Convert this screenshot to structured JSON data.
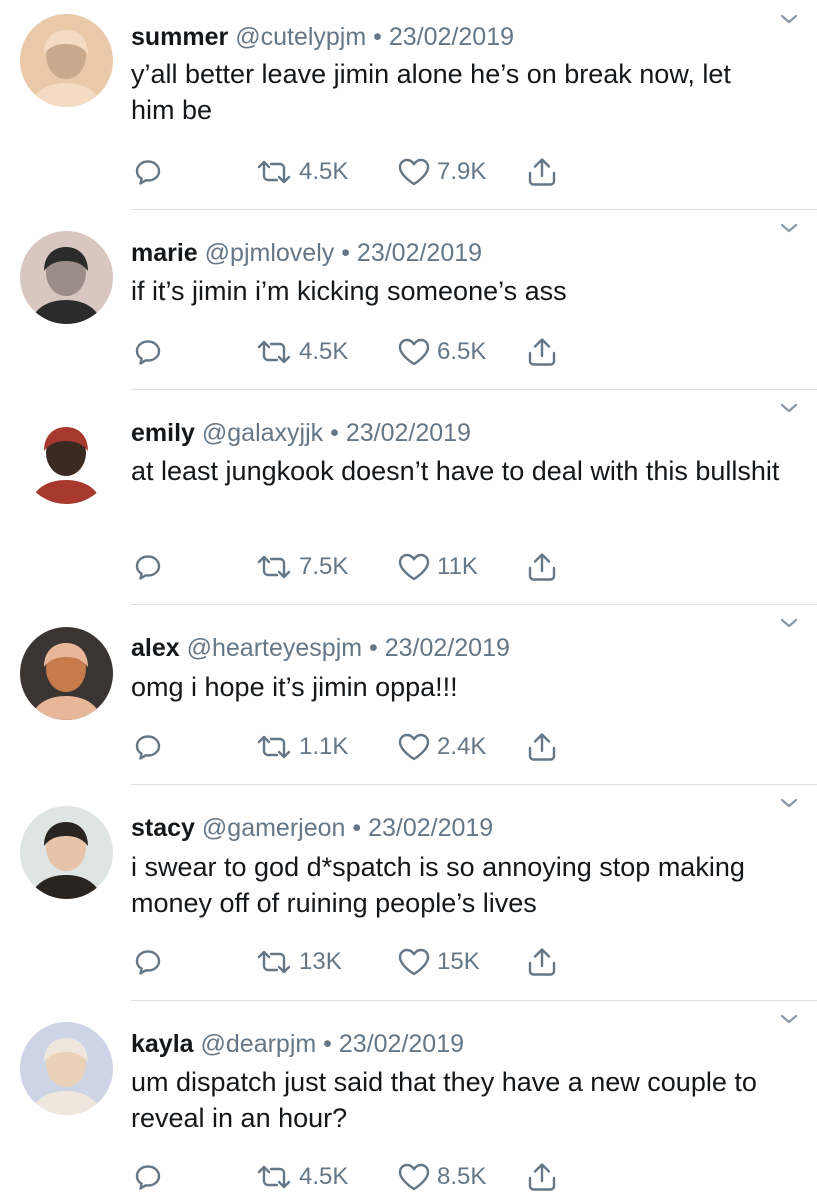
{
  "tweets": [
    {
      "name": "summer",
      "handle": "@cutelypjm",
      "separator": "•",
      "date": "23/02/2019",
      "text": "y’all better leave jimin alone he’s on break now, let him be",
      "retweets": "4.5K",
      "likes": "7.9K",
      "avatar_colors": [
        "#e9c9a8",
        "#f4dcc4",
        "#c9a98b"
      ]
    },
    {
      "name": "marie",
      "handle": "@pjmlovely",
      "separator": "•",
      "date": "23/02/2019",
      "text": "if it’s jimin i’m kicking someone’s ass",
      "retweets": "4.5K",
      "likes": "6.5K",
      "avatar_colors": [
        "#d8c7c0",
        "#2b2b2b",
        "#9a8c86"
      ]
    },
    {
      "name": "emily",
      "handle": "@galaxyjjk",
      "separator": "•",
      "date": "23/02/2019",
      "text": "at least jungkook doesn’t have to deal with this bullshit",
      "retweets": "7.5K",
      "likes": "11K",
      "avatar_colors": [
        "#ffffff",
        "#a8392f",
        "#3a2a22"
      ]
    },
    {
      "name": "alex",
      "handle": "@hearteyespjm",
      "separator": "•",
      "date": "23/02/2019",
      "text": "omg i hope it’s jimin oppa!!!",
      "retweets": "1.1K",
      "likes": "2.4K",
      "avatar_colors": [
        "#3a3533",
        "#e8b79a",
        "#c77a4a"
      ]
    },
    {
      "name": "stacy",
      "handle": "@gamerjeon",
      "separator": "•",
      "date": "23/02/2019",
      "text": "i swear to god d*spatch is so annoying stop making money off of ruining people’s lives",
      "retweets": "13K",
      "likes": "15K",
      "avatar_colors": [
        "#dfe5e2",
        "#2a2420",
        "#e7c4a8"
      ]
    },
    {
      "name": "kayla",
      "handle": "@dearpjm",
      "separator": "•",
      "date": "23/02/2019",
      "text": "um dispatch just said that they have a new couple to reveal in an hour?",
      "retweets": "4.5K",
      "likes": "8.5K",
      "avatar_colors": [
        "#cdd4e6",
        "#efe6de",
        "#e9d2b8"
      ]
    }
  ],
  "icons": {
    "reply": "reply-icon",
    "retweet": "retweet-icon",
    "like": "like-icon",
    "share": "share-icon",
    "more": "chevron-down-icon"
  },
  "colors": {
    "text": "#14171a",
    "secondary": "#657786",
    "divider": "#dcdfe2"
  }
}
